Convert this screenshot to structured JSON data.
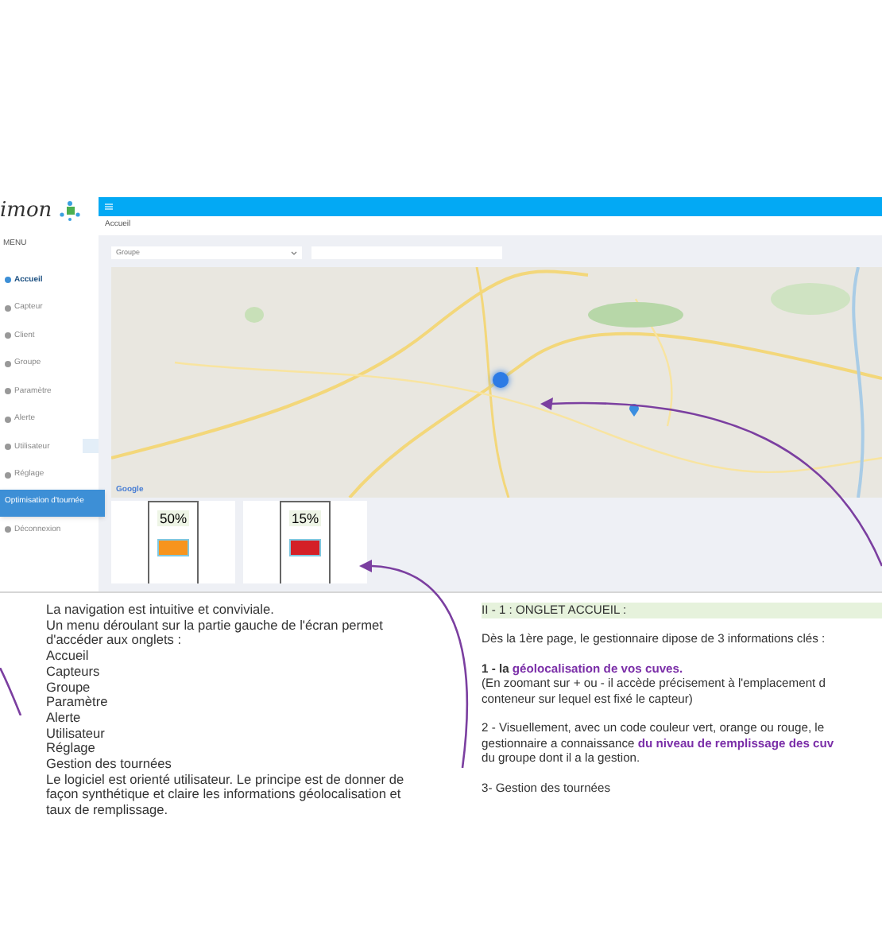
{
  "app": {
    "logo": "imon",
    "menu_title": "MENU",
    "menu": [
      {
        "label": "Accueil",
        "active": true,
        "selected": false
      },
      {
        "label": "Capteur",
        "active": false,
        "selected": false
      },
      {
        "label": "Client",
        "active": false,
        "selected": false
      },
      {
        "label": "Groupe",
        "active": false,
        "selected": false
      },
      {
        "label": "Paramètre",
        "active": false,
        "selected": false
      },
      {
        "label": "Alerte",
        "active": false,
        "selected": false
      },
      {
        "label": "Utilisateur",
        "active": false,
        "selected": false
      },
      {
        "label": "Réglage",
        "active": false,
        "selected": false
      },
      {
        "label": "Optimisation d'tournée",
        "active": false,
        "selected": true
      },
      {
        "label": "Déconnexion",
        "active": false,
        "selected": false
      }
    ],
    "breadcrumb": "Accueil",
    "group_select": {
      "value": "Groupe"
    },
    "map": {
      "attribution": "Google"
    },
    "tanks": [
      {
        "reading": "50%",
        "color": "#f7941d"
      },
      {
        "reading": "15%",
        "color": "#d42027"
      }
    ]
  },
  "left_text": [
    "La navigation est intuitive et conviviale.",
    "Un menu déroulant sur la partie gauche de l'écran permet d'accéder aux onglets :",
    "Accueil",
    "Capteurs",
    "Groupe",
    "Paramètre",
    "Alerte",
    "Utilisateur",
    "Réglage",
    "Gestion des tournées",
    "Le logiciel est orienté utilisateur. Le principe est de donner de façon synthétique et claire les informations géolocalisation et taux de remplissage."
  ],
  "right_heading": "II - 1 : ONGLET ACCUEIL :",
  "right_paragraphs": [
    {
      "lines": [
        [
          {
            "text": "Dès la 1ère page, le gestionnaire dipose de 3 informations clés :",
            "bold": false,
            "highlight": false
          }
        ]
      ]
    },
    {
      "lines": [
        [
          {
            "text": "1 - la ",
            "bold": true,
            "highlight": false
          },
          {
            "text": "géolocalisation de vos cuves.",
            "bold": true,
            "highlight": true
          }
        ],
        [
          {
            "text": "(En zoomant sur + ou - il accède précisement à l'emplacement d",
            "bold": false,
            "highlight": false
          }
        ],
        [
          {
            "text": "conteneur sur lequel est fixé le capteur)",
            "bold": false,
            "highlight": false
          }
        ]
      ]
    },
    {
      "lines": [
        [
          {
            "text": "2 - Visuellement, avec un code couleur vert, orange ou rouge, le",
            "bold": false,
            "highlight": false
          }
        ],
        [
          {
            "text": "gestionnaire a connaissance ",
            "bold": false,
            "highlight": false
          },
          {
            "text": "du niveau de remplissage des cuv",
            "bold": true,
            "highlight": true
          }
        ],
        [
          {
            "text": "du groupe dont il a la gestion.",
            "bold": false,
            "highlight": false
          }
        ]
      ]
    },
    {
      "lines": [
        [
          {
            "text": "3- Gestion des tournées",
            "bold": false,
            "highlight": false
          }
        ]
      ]
    }
  ]
}
